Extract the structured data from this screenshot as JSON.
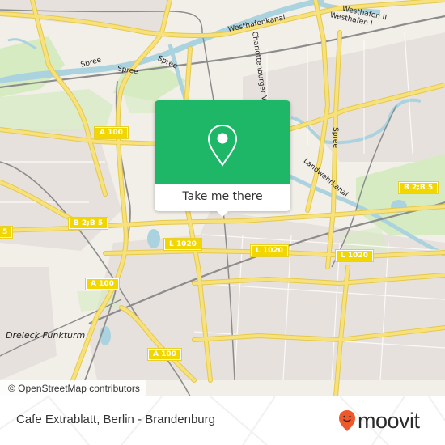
{
  "map": {
    "attribution": "© OpenStreetMap contributors",
    "colors": {
      "land": "#f2efe9",
      "urban": "#e6e0dc",
      "park": "#d8ecc4",
      "water": "#aad3df",
      "road_major": "#f6e27a",
      "road_casing": "#e3c84a",
      "rail": "#8d8d8d",
      "shield": "#f2d600"
    },
    "road_shields": [
      {
        "id": "a100-north",
        "label": "A 100"
      },
      {
        "id": "b2b5-west",
        "label": "B 2;B 5"
      },
      {
        "id": "b5-edge",
        "label": "5"
      },
      {
        "id": "l1020-west",
        "label": "L 1020"
      },
      {
        "id": "l1020-center",
        "label": "L 1020"
      },
      {
        "id": "l1020-east",
        "label": "L 1020"
      },
      {
        "id": "b2b5-east",
        "label": "B 2;B 5"
      },
      {
        "id": "a100-west",
        "label": "A 100"
      },
      {
        "id": "a100-south",
        "label": "A 100"
      }
    ],
    "water_labels": [
      {
        "id": "spree-1",
        "label": "Spree"
      },
      {
        "id": "spree-2",
        "label": "Spree"
      },
      {
        "id": "spree-3",
        "label": "Spree"
      },
      {
        "id": "spree-4",
        "label": "Spree"
      },
      {
        "id": "westhafenkanal",
        "label": "Westhafenkanal"
      },
      {
        "id": "westhafen-2",
        "label": "Westhafen II"
      },
      {
        "id": "westhafen-1",
        "label": "Westhafen I"
      },
      {
        "id": "charlottenburger",
        "label": "Charlottenburger Verbin"
      },
      {
        "id": "landwehrkanal",
        "label": "Landwehrkanal"
      }
    ],
    "place_labels": [
      {
        "id": "dreieck-funkturm",
        "label": "Dreieck Funkturm"
      }
    ]
  },
  "popup": {
    "icon": "location-pin-icon",
    "accent": "#1db767",
    "action_label": "Take me there"
  },
  "footer": {
    "place_name": "Cafe Extrablatt, Berlin - Brandenburg",
    "brand": {
      "name": "moovit",
      "icon": "moovit-smiley-pin-icon",
      "color": "#f0572a"
    }
  }
}
